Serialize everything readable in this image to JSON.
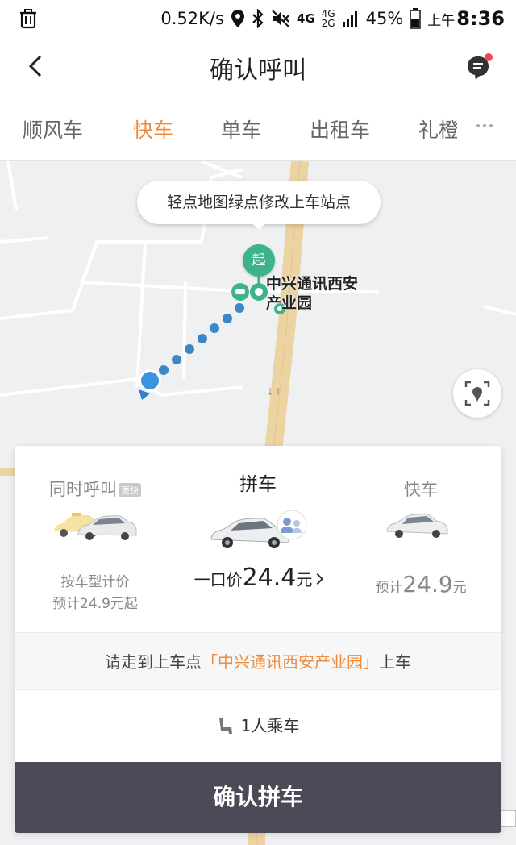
{
  "status_bar": {
    "net_speed": "0.52K/s",
    "network": "4G",
    "network_small_top": "4G",
    "network_small_bottom": "2G",
    "battery": "45%",
    "ampm": "上午",
    "time": "8:36"
  },
  "header": {
    "title": "确认呼叫"
  },
  "tabs": [
    {
      "label": "顺风车"
    },
    {
      "label": "快车"
    },
    {
      "label": "单车"
    },
    {
      "label": "出租车"
    },
    {
      "label": "礼橙"
    }
  ],
  "active_tab": "快车",
  "map": {
    "hint": "轻点地图绿点修改上车站点",
    "start_marker": "起",
    "poi_name_line1": "中兴通讯西安",
    "poi_name_line2": "产业园"
  },
  "options": {
    "left": {
      "name": "同时呼叫",
      "badge": "更快",
      "line1": "按车型计价",
      "line2": "预计24.9元起"
    },
    "mid": {
      "name": "拼车",
      "price_prefix": "一口价",
      "price": "24.4",
      "price_unit": "元"
    },
    "right": {
      "name": "快车",
      "price_prefix": "预计",
      "price": "24.9",
      "price_unit": "元"
    }
  },
  "walk": {
    "prefix": "请走到上车点",
    "poi": "「中兴通讯西安产业园」",
    "suffix": "上车"
  },
  "passenger": {
    "label": "1人乘车"
  },
  "confirm_button": "确认拼车",
  "colors": {
    "accent": "#f08a3c",
    "start_green": "#3cb38c",
    "route_blue": "#3d87c7",
    "road": "#ecd3a2",
    "confirm_bg": "#4a4b56"
  }
}
